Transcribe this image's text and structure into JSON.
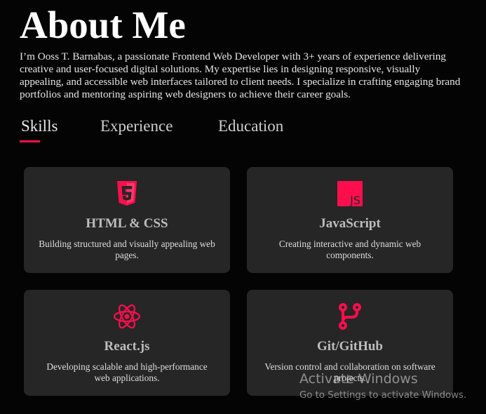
{
  "page": {
    "title": "About Me",
    "bio": "I’m Ooss T. Barnabas, a passionate Frontend Web Developer with 3+ years of experience delivering creative and user-focused digital solutions. My expertise lies in designing responsive, visually appealing, and accessible web interfaces tailored to client needs. I specialize in crafting engaging brand portfolios and mentoring aspiring web designers to achieve their career goals."
  },
  "tabs": [
    {
      "label": "Skills",
      "active": true
    },
    {
      "label": "Experience",
      "active": false
    },
    {
      "label": "Education",
      "active": false
    }
  ],
  "skills": [
    {
      "icon": "html5-icon",
      "title": "HTML & CSS",
      "description": "Building structured and visually appealing web pages."
    },
    {
      "icon": "javascript-icon",
      "title": "JavaScript",
      "description": "Creating interactive and dynamic web components."
    },
    {
      "icon": "react-icon",
      "title": "React.js",
      "description": "Developing scalable and high-performance web applications."
    },
    {
      "icon": "git-branch-icon",
      "title": "Git/GitHub",
      "description": "Version control and collaboration on software projects."
    }
  ],
  "watermark": {
    "title": "Activate Windows",
    "subtitle": "Go to Settings to activate Windows."
  },
  "colors": {
    "background": "#050405",
    "card": "#262626",
    "accent": "#ff0e4e"
  }
}
